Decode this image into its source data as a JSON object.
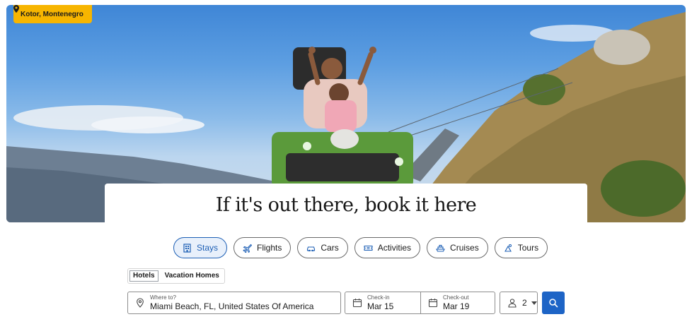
{
  "hero": {
    "location": "Kotor, Montenegro",
    "headline": "If it's out there, book it here"
  },
  "categories": [
    {
      "label": "Stays",
      "icon": "hotel-icon",
      "active": true
    },
    {
      "label": "Flights",
      "icon": "plane-icon",
      "active": false
    },
    {
      "label": "Cars",
      "icon": "car-icon",
      "active": false
    },
    {
      "label": "Activities",
      "icon": "ticket-icon",
      "active": false
    },
    {
      "label": "Cruises",
      "icon": "ship-icon",
      "active": false
    },
    {
      "label": "Tours",
      "icon": "tour-icon",
      "active": false
    }
  ],
  "subtabs": [
    {
      "label": "Hotels",
      "active": true
    },
    {
      "label": "Vacation Homes",
      "active": false
    }
  ],
  "search": {
    "destination_label": "Where to?",
    "destination_value": "Miami Beach, FL, United States Of America",
    "checkin_label": "Check-in",
    "checkin_value": "Mar 15",
    "checkout_label": "Check-out",
    "checkout_value": "Mar 19",
    "guests_value": "2"
  },
  "colors": {
    "badge": "#f7b500",
    "accent": "#1d64c6",
    "active_pill_bg": "#e8f0fb"
  }
}
